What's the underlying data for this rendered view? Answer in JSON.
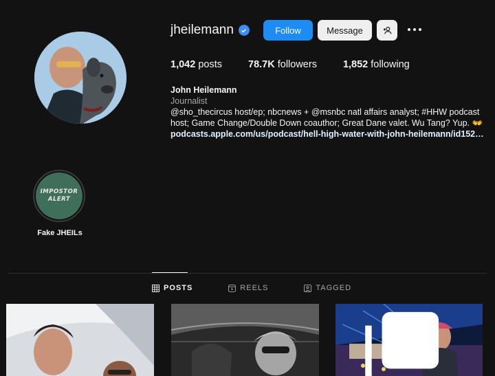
{
  "profile": {
    "username": "jheilemann",
    "verified": true
  },
  "actions": {
    "follow": "Follow",
    "message": "Message"
  },
  "stats": {
    "posts_count": "1,042",
    "posts_label": "posts",
    "followers_count": "78.7K",
    "followers_label": "followers",
    "following_count": "1,852",
    "following_label": "following"
  },
  "bio": {
    "name": "John Heilemann",
    "category": "Journalist",
    "text": "@sho_thecircus host/ep; nbcnews + @msnbc natl affairs analyst; #HHW podcast host; Game Change/Double Down coauthor; Great Dane valet. Wu Tang? Yup. 👐",
    "link": "podcasts.apple.com/us/podcast/hell-high-water-with-john-heilemann/id15293..."
  },
  "highlights": [
    {
      "cover_line1": "IMPOSTOR",
      "cover_line2": "ALERT",
      "label": "Fake JHEILs"
    }
  ],
  "tabs": [
    {
      "label": "POSTS",
      "icon": "grid-icon",
      "active": true
    },
    {
      "label": "REELS",
      "icon": "reels-icon",
      "active": false
    },
    {
      "label": "TAGGED",
      "icon": "tagged-icon",
      "active": false
    }
  ],
  "colors": {
    "background": "#121212",
    "follow_button": "#1d8cf5",
    "verified_badge": "#3d8ef0",
    "highlight_cover": "#3f6f5a"
  }
}
